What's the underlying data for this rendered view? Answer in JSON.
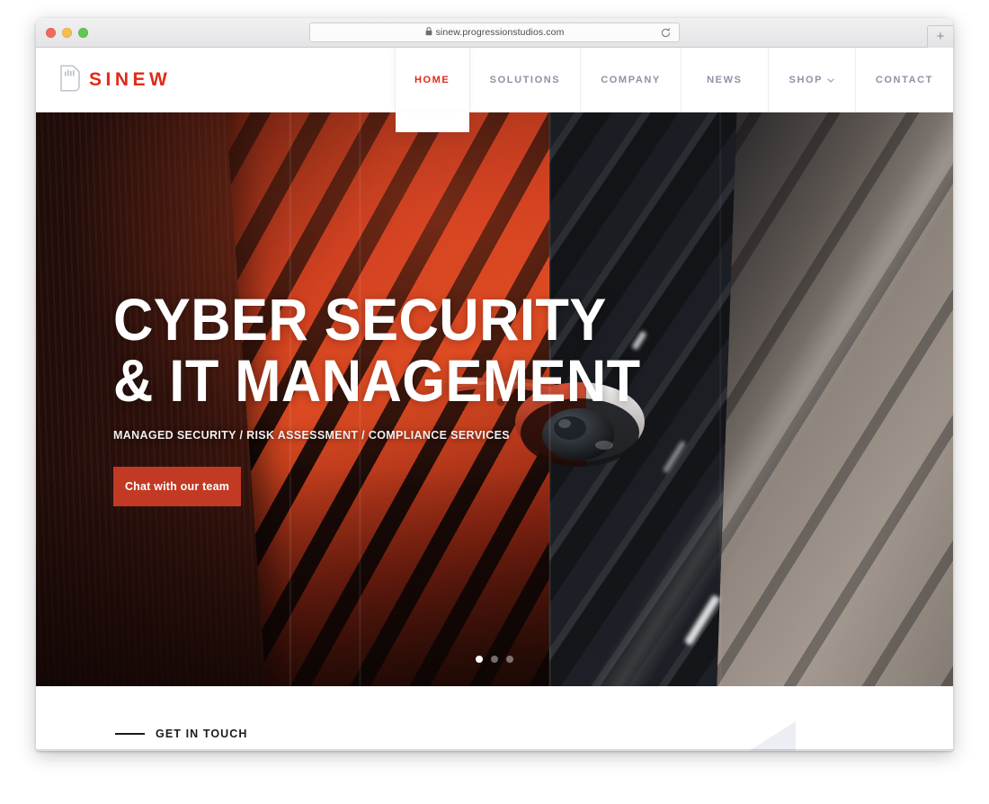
{
  "browser": {
    "url": "sinew.progressionstudios.com",
    "lock_icon": "lock-icon",
    "reload_icon": "reload-icon",
    "new_tab_label": "+",
    "traffic_lights": [
      "close-red",
      "minimize-yellow",
      "zoom-green"
    ]
  },
  "site": {
    "brand": {
      "name": "SINEW",
      "mark_icon": "shield-signal-icon"
    },
    "nav": [
      {
        "label": "HOME",
        "active": true,
        "has_dropdown": false
      },
      {
        "label": "SOLUTIONS",
        "active": false,
        "has_dropdown": false
      },
      {
        "label": "COMPANY",
        "active": false,
        "has_dropdown": false
      },
      {
        "label": "NEWS",
        "active": false,
        "has_dropdown": false
      },
      {
        "label": "SHOP",
        "active": false,
        "has_dropdown": true,
        "chevron": "⌄"
      },
      {
        "label": "CONTACT",
        "active": false,
        "has_dropdown": false
      }
    ],
    "hero": {
      "title_line_1": "CYBER SECURITY",
      "title_line_2": "& IT MANAGEMENT",
      "subtitle": "MANAGED SECURITY / RISK ASSESSMENT / COMPLIANCE SERVICES",
      "cta_label": "Chat with our team",
      "slides_total": 3,
      "slide_active": 1,
      "image_description": "security camera mounted on louvered building facade, split red / grey duotone"
    },
    "contact_strip": {
      "label": "GET IN TOUCH"
    }
  },
  "colors": {
    "accent_red": "#e02b16",
    "button_red": "#c23a24",
    "nav_text": "#8c93a6",
    "dark_text": "#1b1b1f",
    "hero_overlay_red": "#c3381c",
    "hero_overlay_grey": "#b6aba1",
    "deco_grey": "#eceef3"
  }
}
